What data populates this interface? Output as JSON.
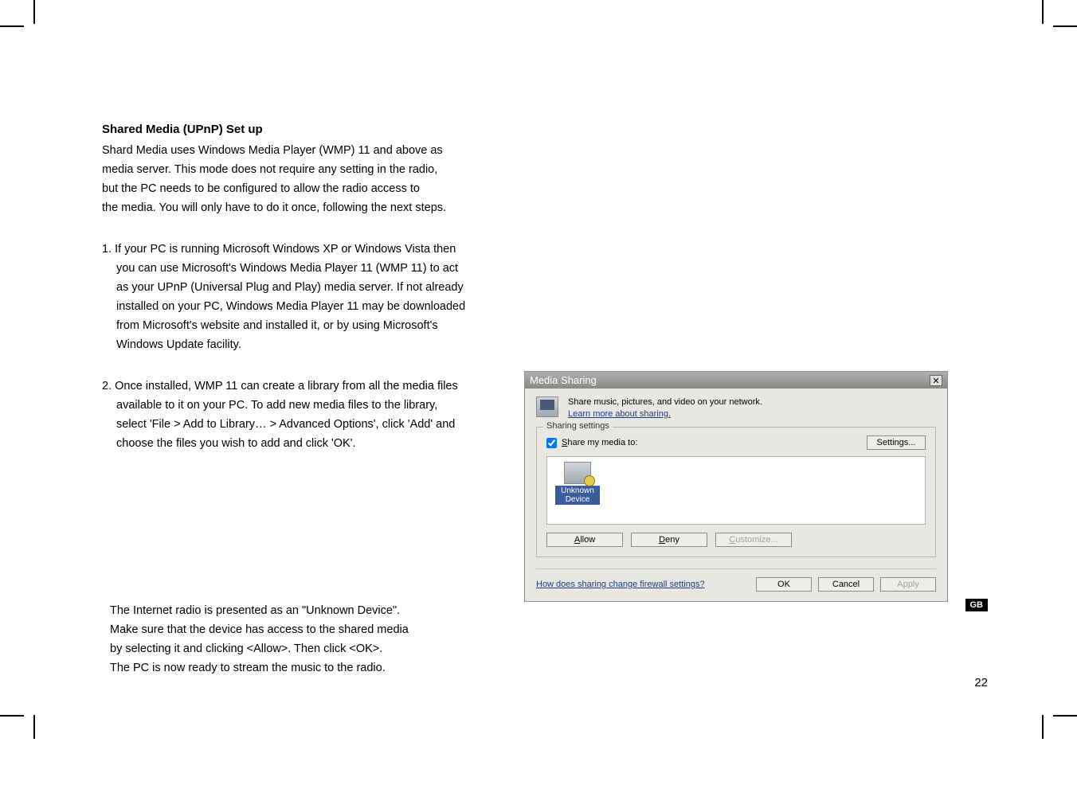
{
  "doc": {
    "heading": "Shared Media (UPnP) Set up",
    "intro": [
      "Shard Media uses Windows Media Player (WMP) 11 and above as",
      "media server. This mode does not require any setting in the radio,",
      "but the PC needs to be configured to allow the radio access to",
      "the media. You will only have to do it once, following the next steps."
    ],
    "step1": [
      "1. If your PC is running Microsoft Windows XP or Windows Vista then",
      "you can use Microsoft's Windows Media Player 11 (WMP 11) to act",
      "as your UPnP (Universal Plug and Play) media server. If not already",
      "installed on your PC, Windows Media Player 11 may be downloaded",
      "from Microsoft's website and installed it, or by using Microsoft's",
      "Windows Update facility."
    ],
    "step2": [
      "2. Once installed, WMP 11 can create a library from all the media files",
      "available to it on your PC. To add new media files to the library,",
      "select 'File > Add to Library… > Advanced Options', click 'Add' and",
      "choose the files you wish to add and click 'OK'."
    ],
    "after": [
      "The Internet radio is presented as an \"Unknown Device\".",
      "Make sure that the device has access to the shared media",
      "by selecting it and clicking <Allow>. Then click <OK>.",
      "The PC is now ready to stream the music to the radio."
    ]
  },
  "dialog": {
    "title": "Media Sharing",
    "desc": "Share music, pictures, and video on your network.",
    "learn_more": "Learn more about sharing.",
    "group_title": "Sharing settings",
    "share_label_pre": "S",
    "share_label": "hare my media to:",
    "settings_btn": "Settings...",
    "device_line1": "Unknown",
    "device_line2": "Device",
    "allow_pre": "A",
    "allow": "llow",
    "deny_pre": "D",
    "deny": "eny",
    "customize_pre": "C",
    "customize": "ustomize...",
    "firewall_link": "How does sharing change firewall settings?",
    "ok": "OK",
    "cancel": "Cancel",
    "apply": "Apply"
  },
  "page_number": "22",
  "lang_tab": "GB"
}
